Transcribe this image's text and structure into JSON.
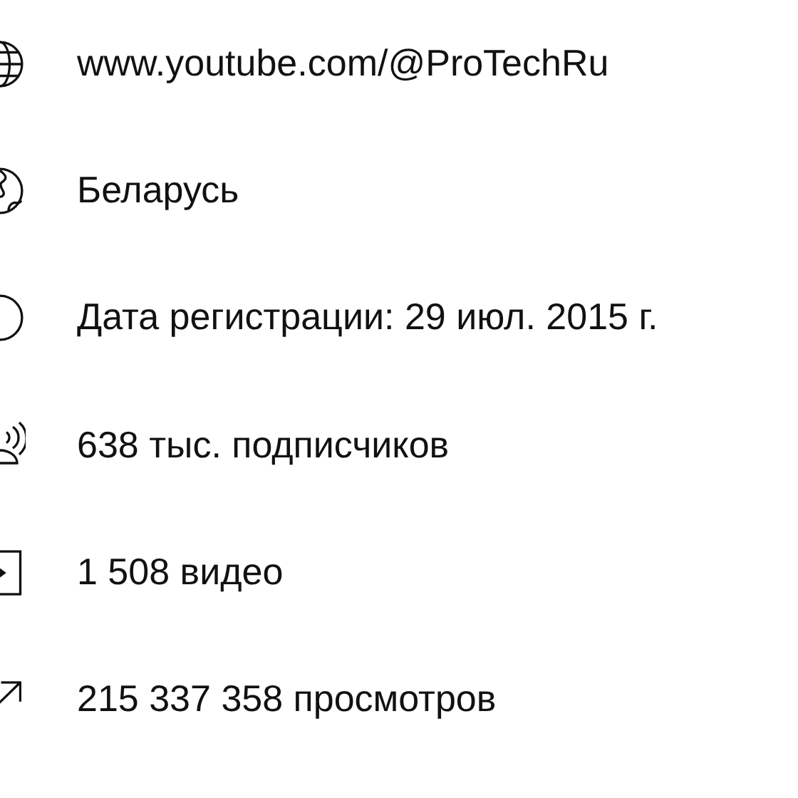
{
  "details": [
    {
      "kind": "link",
      "text": "www.youtube.com/@ProTechRu"
    },
    {
      "kind": "country",
      "text": "Беларусь"
    },
    {
      "kind": "joined",
      "text": "Дата регистрации: 29 июл. 2015 г."
    },
    {
      "kind": "subscribers",
      "text": "638 тыс. подписчиков"
    },
    {
      "kind": "videos",
      "text": "1 508 видео"
    },
    {
      "kind": "views",
      "text": "215 337 358 просмотров"
    }
  ]
}
